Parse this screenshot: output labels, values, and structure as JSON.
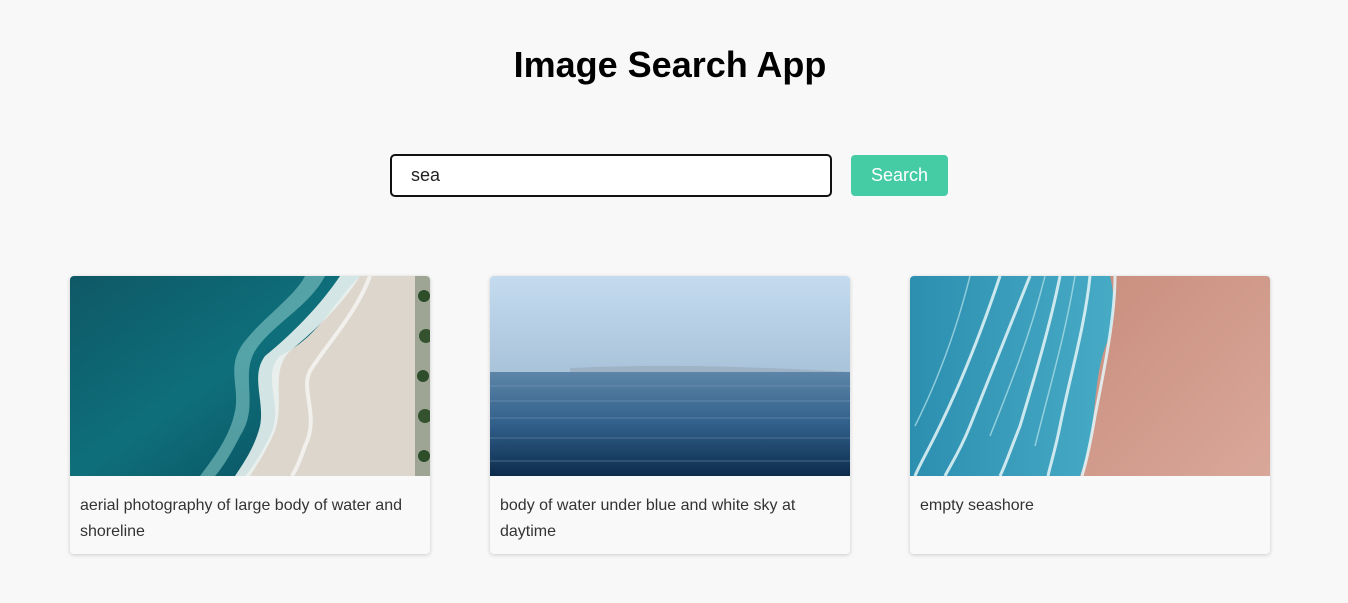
{
  "header": {
    "title": "Image Search App"
  },
  "search": {
    "value": "sea",
    "button_label": "Search",
    "button_color": "#46cca5"
  },
  "results": [
    {
      "caption": "aerial photography of large body of water and shoreline"
    },
    {
      "caption": "body of water under blue and white sky at daytime"
    },
    {
      "caption": "empty seashore"
    }
  ]
}
